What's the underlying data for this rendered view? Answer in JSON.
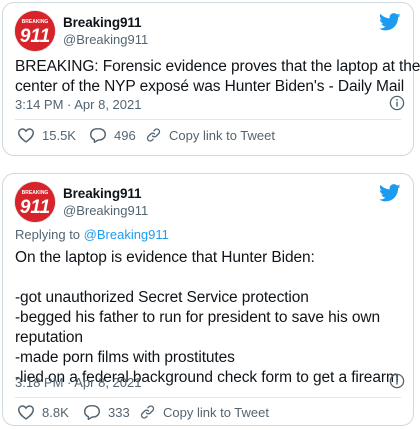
{
  "tweets": [
    {
      "display_name": "Breaking911",
      "handle": "@Breaking911",
      "avatar_text": "911",
      "text": "BREAKING: Forensic evidence proves that the laptop at the center of the NYP exposé was Hunter Biden's - Daily Mail",
      "text_lines": [
        "BREAKING: Forensic evidence proves that the laptop at the",
        "center of the NYP exposé was Hunter Biden's - Daily Mail"
      ],
      "timestamp": "3:14 PM · Apr 8, 2021",
      "likes": "15.5K",
      "replies": "496",
      "copy_link_label": "Copy link to Tweet"
    },
    {
      "display_name": "Breaking911",
      "handle": "@Breaking911",
      "avatar_text": "911",
      "replying_prefix": "Replying to ",
      "replying_to": "@Breaking911",
      "text_lines": [
        "On the laptop is evidence that Hunter Biden:",
        "",
        "-got unauthorized Secret Service protection",
        "-begged his father to run for president to save his own",
        "reputation",
        "-made porn films with prostitutes",
        "-lied on a federal background check form to get a firearm"
      ],
      "timestamp": "3:18 PM · Apr 8, 2021",
      "likes": "8.8K",
      "replies": "333",
      "copy_link_label": "Copy link to Tweet"
    }
  ],
  "colors": {
    "twitter_blue": "#1d9bf0",
    "avatar_red": "#d7242a",
    "secondary_text": "#536471",
    "border": "#cfd9de"
  },
  "icons": [
    "twitter-bird-icon",
    "info-icon",
    "heart-icon",
    "reply-bubble-icon",
    "link-icon"
  ]
}
